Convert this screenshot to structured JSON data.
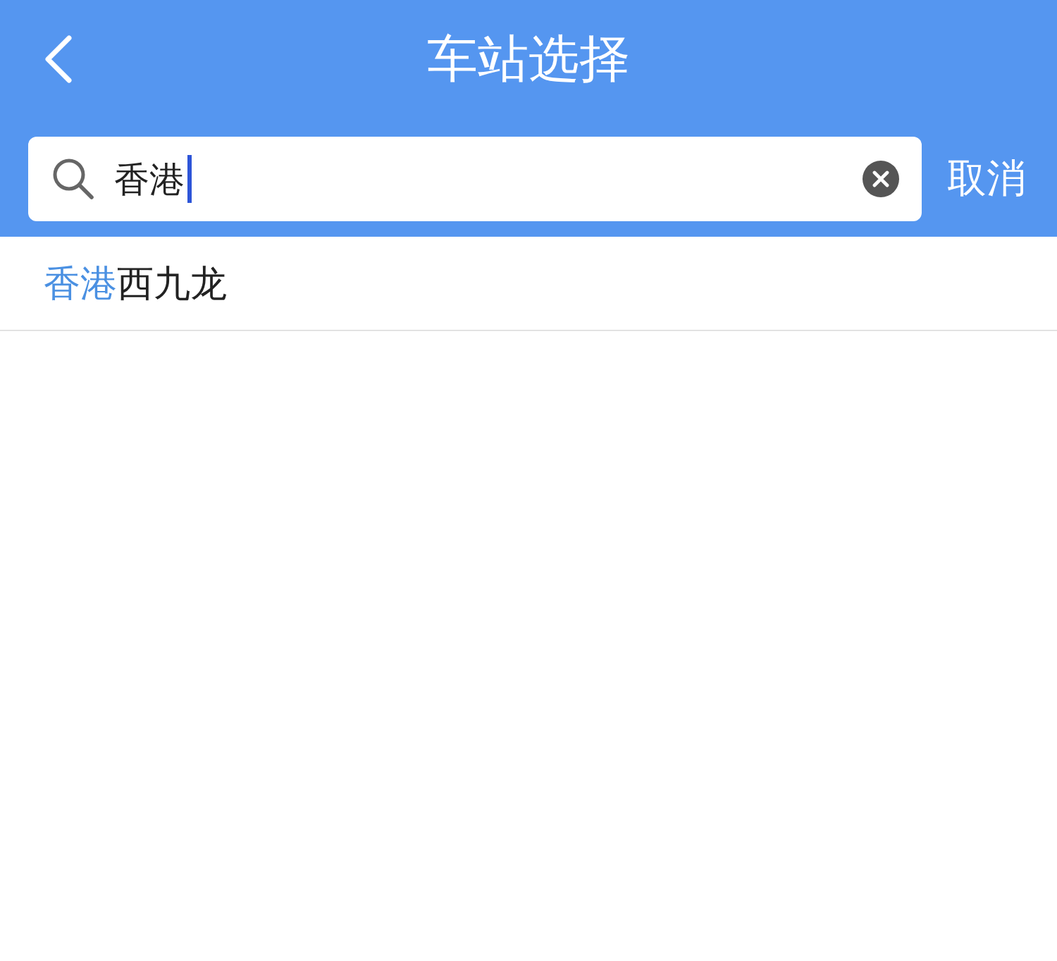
{
  "header": {
    "title": "车站选择"
  },
  "search": {
    "value": "香港",
    "cancel": "取消"
  },
  "results": [
    {
      "match": "香港",
      "rest": "西九龙"
    }
  ]
}
